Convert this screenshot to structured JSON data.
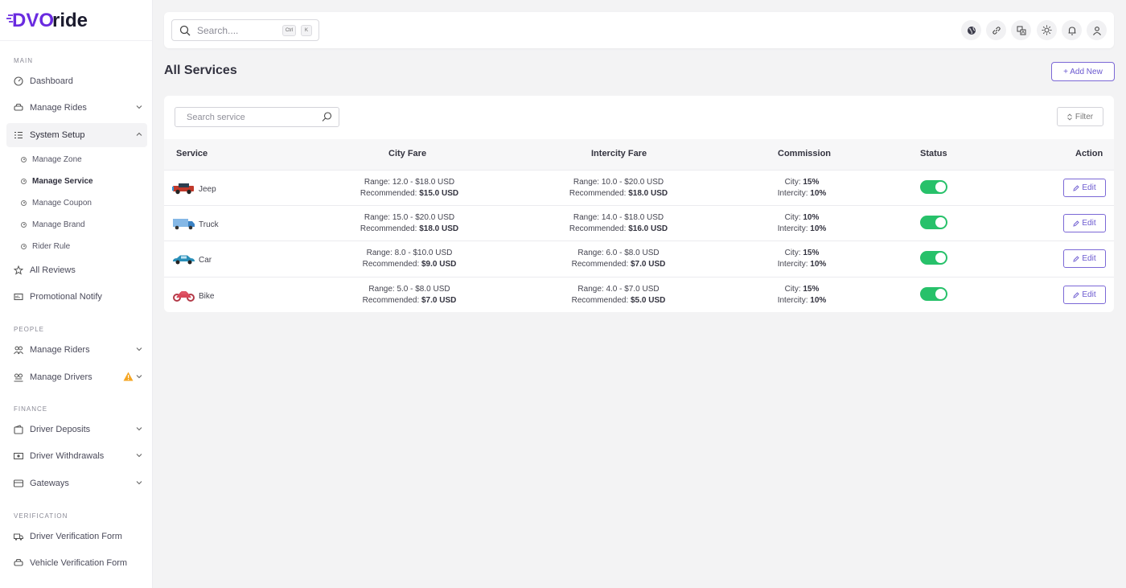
{
  "brand": {
    "logo_dv": "DVO",
    "logo_ride": "ride",
    "colors": {
      "purple": "#6a2be0",
      "dark": "#1b1b2e"
    }
  },
  "sidebar": {
    "sections": {
      "main": "MAIN",
      "people": "PEOPLE",
      "finance": "FINANCE",
      "verification": "VERIFICATION"
    },
    "items": [
      {
        "label": "Dashboard",
        "icon": "dashboard-icon"
      },
      {
        "label": "Manage Rides",
        "icon": "car-icon"
      },
      {
        "label": "System Setup",
        "icon": "list-settings-icon",
        "expanded": true
      },
      {
        "label": "All Reviews",
        "icon": "star-icon"
      },
      {
        "label": "Promotional Notify",
        "icon": "megaphone-icon"
      },
      {
        "label": "Manage Riders",
        "icon": "users-icon"
      },
      {
        "label": "Manage Drivers",
        "icon": "drivers-icon",
        "warning": true
      },
      {
        "label": "Driver Deposits",
        "icon": "wallet-icon"
      },
      {
        "label": "Driver Withdrawals",
        "icon": "cash-icon"
      },
      {
        "label": "Gateways",
        "icon": "card-icon"
      },
      {
        "label": "Driver Verification Form",
        "icon": "truck-icon"
      },
      {
        "label": "Vehicle Verification Form",
        "icon": "car-icon"
      }
    ],
    "subitems": [
      {
        "label": "Manage Zone"
      },
      {
        "label": "Manage Service",
        "active": true
      },
      {
        "label": "Manage Coupon"
      },
      {
        "label": "Manage Brand"
      },
      {
        "label": "Rider Rule"
      }
    ]
  },
  "topbar": {
    "search_placeholder": "Search....",
    "kbd_ctrl": "Ctrl",
    "kbd_k": "K",
    "icons": [
      "globe-icon",
      "link-icon",
      "translate-icon",
      "sun-icon",
      "bell-icon",
      "user-icon"
    ]
  },
  "page": {
    "title": "All Services",
    "add_new": "+ Add New"
  },
  "table": {
    "search_placeholder": "Search service",
    "filter_label": "Filter",
    "headers": {
      "service": "Service",
      "city_fare": "City Fare",
      "intercity_fare": "Intercity Fare",
      "commission": "Commission",
      "status": "Status",
      "action": "Action"
    },
    "range_label": "Range: ",
    "recommended_label": "Recommended: ",
    "city_label": "City: ",
    "intercity_label": "Intercity: ",
    "edit_label": "Edit",
    "rows": [
      {
        "service": "Jeep",
        "city_range": "12.0 - $18.0 USD",
        "city_rec": "$15.0 USD",
        "inter_range": "10.0 - $20.0 USD",
        "inter_rec": "$18.0 USD",
        "comm_city": "15%",
        "comm_inter": "10%",
        "status": true
      },
      {
        "service": "Truck",
        "city_range": "15.0 - $20.0 USD",
        "city_rec": "$18.0 USD",
        "inter_range": "14.0 - $18.0 USD",
        "inter_rec": "$16.0 USD",
        "comm_city": "10%",
        "comm_inter": "10%",
        "status": true
      },
      {
        "service": "Car",
        "city_range": "8.0 - $10.0 USD",
        "city_rec": "$9.0 USD",
        "inter_range": "6.0 - $8.0 USD",
        "inter_rec": "$7.0 USD",
        "comm_city": "15%",
        "comm_inter": "10%",
        "status": true
      },
      {
        "service": "Bike",
        "city_range": "5.0 - $8.0 USD",
        "city_rec": "$7.0 USD",
        "inter_range": "4.0 - $7.0 USD",
        "inter_rec": "$5.0 USD",
        "comm_city": "15%",
        "comm_inter": "10%",
        "status": true
      }
    ]
  }
}
